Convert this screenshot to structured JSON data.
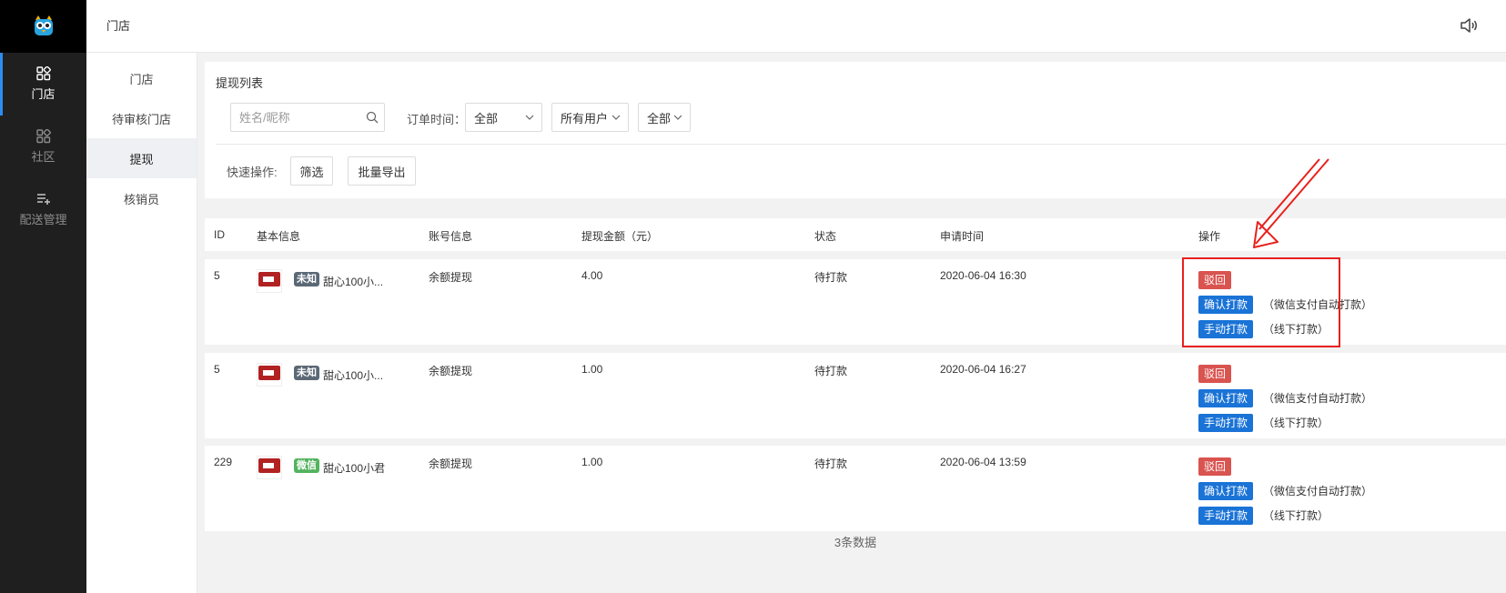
{
  "nav": {
    "items": [
      {
        "label": "门店",
        "icon": "apps-icon",
        "active": true
      },
      {
        "label": "社区",
        "icon": "apps-icon",
        "active": false
      },
      {
        "label": "配送管理",
        "icon": "list-add-icon",
        "active": false
      }
    ]
  },
  "header": {
    "title": "门店"
  },
  "subnav": {
    "items": [
      {
        "label": "门店"
      },
      {
        "label": "待审核门店"
      },
      {
        "label": "提现"
      },
      {
        "label": "核销员"
      }
    ]
  },
  "filter": {
    "title": "提现列表",
    "search_placeholder": "姓名/昵称",
    "order_time_label": "订单时间：",
    "order_time_value": "全部",
    "user_value": "所有用户",
    "status_value": "全部",
    "quick_label": "快速操作:",
    "filter_btn": "筛选",
    "export_btn": "批量导出"
  },
  "table": {
    "headers": [
      "ID",
      "基本信息",
      "账号信息",
      "提现金额（元）",
      "状态",
      "申请时间",
      "操作"
    ],
    "rows": [
      {
        "id": "5",
        "badge": "未知",
        "badge_type": "unknown",
        "nick": "甜心100小...",
        "account": "余额提现",
        "amount": "4.00",
        "status": "待打款",
        "time": "2020-06-04 16:30"
      },
      {
        "id": "5",
        "badge": "未知",
        "badge_type": "unknown",
        "nick": "甜心100小...",
        "account": "余额提现",
        "amount": "1.00",
        "status": "待打款",
        "time": "2020-06-04 16:27"
      },
      {
        "id": "229",
        "badge": "微信",
        "badge_type": "wechat",
        "nick": "甜心100小君",
        "account": "余额提现",
        "amount": "1.00",
        "status": "待打款",
        "time": "2020-06-04 13:59"
      }
    ],
    "ops": {
      "reject": "驳回",
      "confirm": "确认打款",
      "confirm_note": "（微信支付自动打款）",
      "manual": "手动打款",
      "manual_note": "（线下打款）"
    },
    "footer": "3条数据"
  },
  "colors": {
    "accent": "#1a73d6",
    "danger": "#d9534f",
    "annotation": "#e8211d"
  }
}
